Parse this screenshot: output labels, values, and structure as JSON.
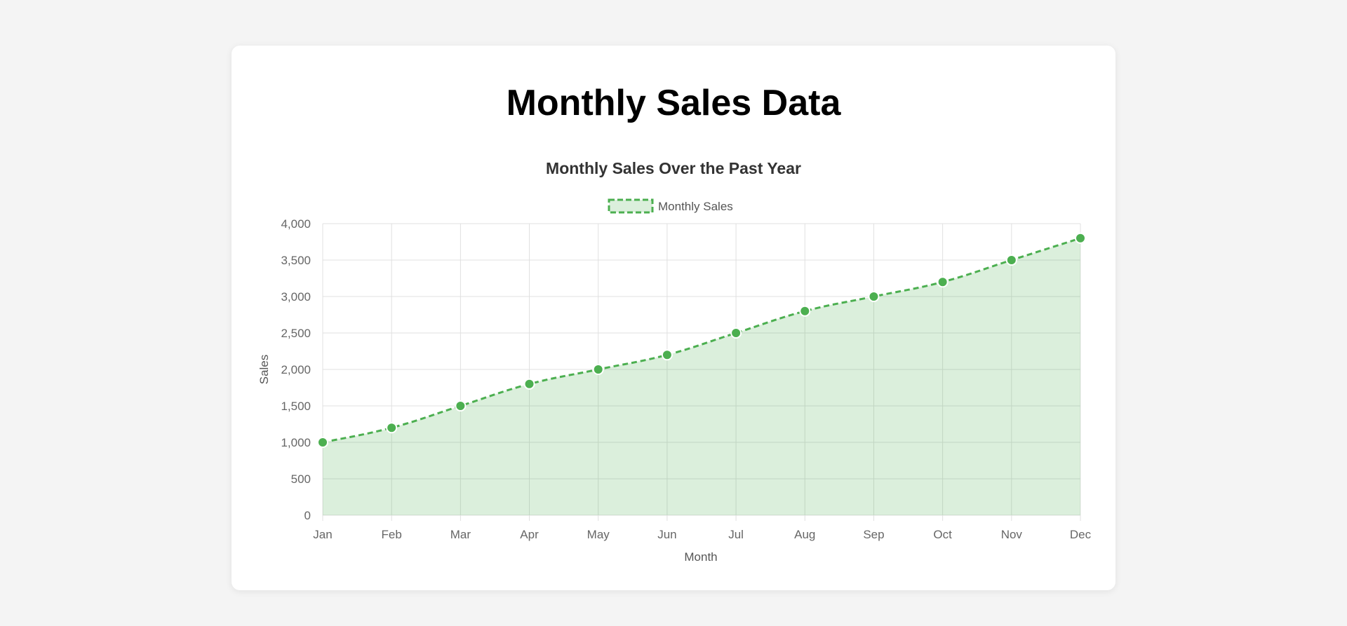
{
  "page": {
    "title": "Monthly Sales Data"
  },
  "colors": {
    "line": "#4caf50",
    "fill": "rgba(76, 175, 80, 0.2)",
    "grid": "#e0e0e0",
    "point_border": "#ffffff"
  },
  "chart_data": {
    "type": "area",
    "title": "Monthly Sales Over the Past Year",
    "xlabel": "Month",
    "ylabel": "Sales",
    "categories": [
      "Jan",
      "Feb",
      "Mar",
      "Apr",
      "May",
      "Jun",
      "Jul",
      "Aug",
      "Sep",
      "Oct",
      "Nov",
      "Dec"
    ],
    "series": [
      {
        "name": "Monthly Sales",
        "values": [
          1000,
          1200,
          1500,
          1800,
          2000,
          2200,
          2500,
          2800,
          3000,
          3200,
          3500,
          3800
        ],
        "line_style": "dashed"
      }
    ],
    "ylim": [
      0,
      4000
    ],
    "yticks": [
      "0",
      "500",
      "1,000",
      "1,500",
      "2,000",
      "2,500",
      "3,000",
      "3,500",
      "4,000"
    ],
    "ytick_values": [
      0,
      500,
      1000,
      1500,
      2000,
      2500,
      3000,
      3500,
      4000
    ],
    "grid": true,
    "legend": "top-center"
  }
}
